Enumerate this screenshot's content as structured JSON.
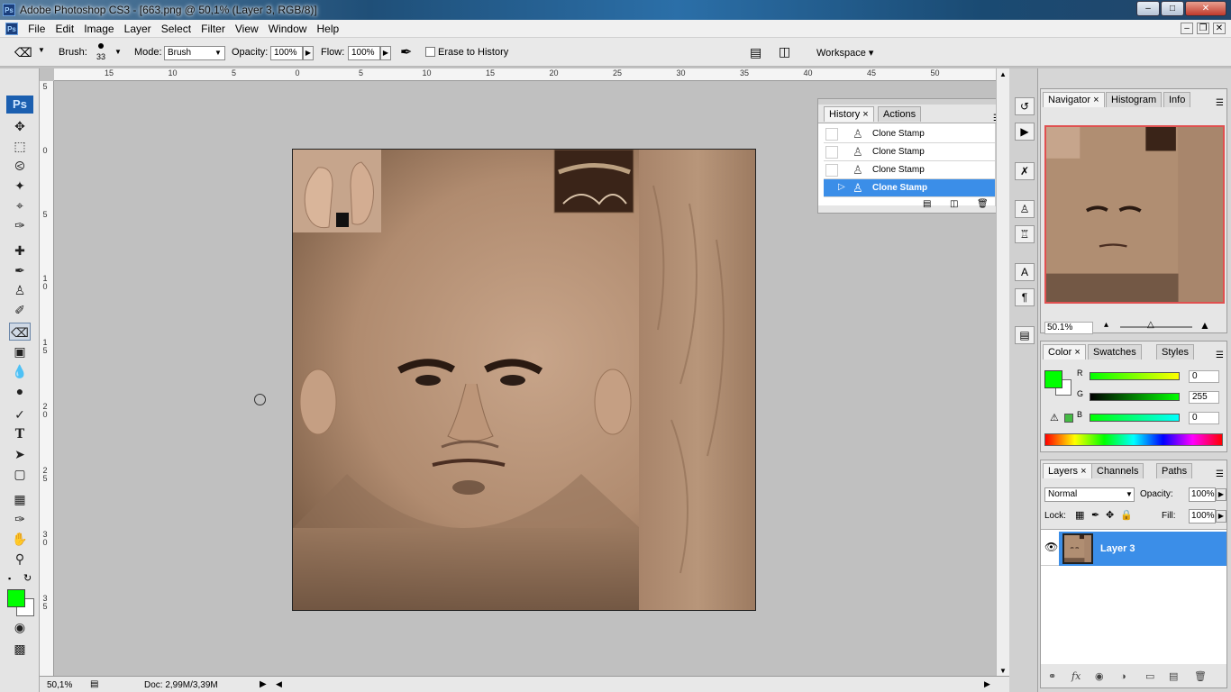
{
  "window": {
    "title": "Adobe Photoshop CS3 - [663.png @ 50,1% (Layer 3, RGB/8)]",
    "app_icon": "Ps",
    "min": "–",
    "max": "□",
    "close": "✕",
    "inner_min": "–",
    "inner_restore": "❐",
    "inner_close": "✕"
  },
  "menu": [
    "File",
    "Edit",
    "Image",
    "Layer",
    "Select",
    "Filter",
    "View",
    "Window",
    "Help"
  ],
  "options": {
    "brush_label": "Brush:",
    "brush_size": "33",
    "mode_label": "Mode:",
    "mode_value": "Brush",
    "opacity_label": "Opacity:",
    "opacity_value": "100%",
    "flow_label": "Flow:",
    "flow_value": "100%",
    "erase_history_label": "Erase to History",
    "workspace_label": "Workspace ▾"
  },
  "rulers": {
    "top": [
      "15",
      "10",
      "5",
      "0",
      "5",
      "10",
      "15",
      "20",
      "25",
      "30",
      "35",
      "40",
      "45",
      "50"
    ],
    "left": [
      "5",
      "0",
      "5",
      "1 0",
      "1 5",
      "2 0",
      "2 5",
      "3 0",
      "3 5"
    ]
  },
  "history": {
    "tabs": [
      "History",
      "Actions"
    ],
    "rows": [
      {
        "label": "Clone Stamp"
      },
      {
        "label": "Clone Stamp"
      },
      {
        "label": "Clone Stamp"
      },
      {
        "label": "Clone Stamp",
        "selected": true
      }
    ]
  },
  "navigator": {
    "tabs": [
      "Navigator",
      "Histogram",
      "Info"
    ],
    "zoom": "50.1%"
  },
  "color": {
    "tabs": [
      "Color",
      "Swatches",
      "Styles"
    ],
    "r_label": "R",
    "r_value": "0",
    "g_label": "G",
    "g_value": "255",
    "b_label": "B",
    "b_value": "0",
    "foreground": "#00ff00",
    "background": "#ffffff"
  },
  "layers": {
    "tabs": [
      "Layers",
      "Channels",
      "Paths"
    ],
    "blend": "Normal",
    "opacity_label": "Opacity:",
    "opacity_value": "100%",
    "lock_label": "Lock:",
    "fill_label": "Fill:",
    "fill_value": "100%",
    "layer_name": "Layer 3"
  },
  "status": {
    "zoom": "50,1%",
    "doc": "Doc: 2,99M/3,39M"
  },
  "toolbox": {
    "fg": "#00ff00",
    "bg": "#ffffff"
  }
}
